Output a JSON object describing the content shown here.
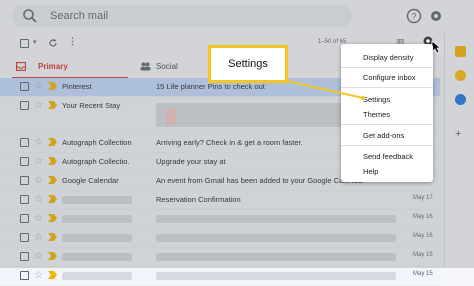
{
  "search": {
    "placeholder": "Search mail"
  },
  "toolbar": {
    "pagination": "1–50 of 65"
  },
  "tabs": [
    {
      "label": "Primary"
    },
    {
      "label": "Social"
    }
  ],
  "rows": [
    {
      "sender": "Pinterest",
      "subject": "15 Life planner Pins to check out",
      "date": ""
    },
    {
      "sender": "Your Recent Stay",
      "subject": "",
      "date": ""
    },
    {
      "sender": "Autograph Collection",
      "subject": "Arriving early? Check in & get a room faster.",
      "date": ""
    },
    {
      "sender": "Autograph Collectio.",
      "subject": "Upgrade your stay at",
      "date": ""
    },
    {
      "sender": "Google Calendar",
      "subject": "An event from Gmail has been added to your Google Calendar",
      "date": ""
    },
    {
      "sender": "",
      "subject": "Reservation Confirmation",
      "date": "May 17"
    },
    {
      "sender": "",
      "subject": "",
      "date": "May 16"
    },
    {
      "sender": "",
      "subject": "",
      "date": "May 16"
    },
    {
      "sender": "",
      "subject": "",
      "date": "May 15"
    },
    {
      "sender": "",
      "subject": "",
      "date": "May 15"
    }
  ],
  "menu": {
    "items": [
      "Display density",
      "Configure inbox",
      "Settings",
      "Themes",
      "Get add-ons",
      "Send feedback",
      "Help"
    ]
  },
  "callout": {
    "label": "Settings"
  },
  "colors": {
    "accent_red": "#d93025",
    "highlight_yellow": "#f3c623",
    "selected_row": "#c2dbff"
  }
}
